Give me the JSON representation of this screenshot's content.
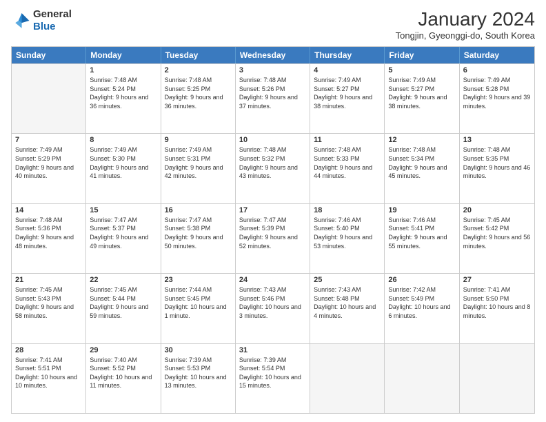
{
  "header": {
    "logo_general": "General",
    "logo_blue": "Blue",
    "month_title": "January 2024",
    "subtitle": "Tongjin, Gyeonggi-do, South Korea"
  },
  "weekdays": [
    "Sunday",
    "Monday",
    "Tuesday",
    "Wednesday",
    "Thursday",
    "Friday",
    "Saturday"
  ],
  "rows": [
    [
      {
        "day": "",
        "empty": true
      },
      {
        "day": "1",
        "sunrise": "7:48 AM",
        "sunset": "5:24 PM",
        "daylight": "9 hours and 36 minutes."
      },
      {
        "day": "2",
        "sunrise": "7:48 AM",
        "sunset": "5:25 PM",
        "daylight": "9 hours and 36 minutes."
      },
      {
        "day": "3",
        "sunrise": "7:48 AM",
        "sunset": "5:26 PM",
        "daylight": "9 hours and 37 minutes."
      },
      {
        "day": "4",
        "sunrise": "7:49 AM",
        "sunset": "5:27 PM",
        "daylight": "9 hours and 38 minutes."
      },
      {
        "day": "5",
        "sunrise": "7:49 AM",
        "sunset": "5:27 PM",
        "daylight": "9 hours and 38 minutes."
      },
      {
        "day": "6",
        "sunrise": "7:49 AM",
        "sunset": "5:28 PM",
        "daylight": "9 hours and 39 minutes."
      }
    ],
    [
      {
        "day": "7",
        "sunrise": "7:49 AM",
        "sunset": "5:29 PM",
        "daylight": "9 hours and 40 minutes."
      },
      {
        "day": "8",
        "sunrise": "7:49 AM",
        "sunset": "5:30 PM",
        "daylight": "9 hours and 41 minutes."
      },
      {
        "day": "9",
        "sunrise": "7:49 AM",
        "sunset": "5:31 PM",
        "daylight": "9 hours and 42 minutes."
      },
      {
        "day": "10",
        "sunrise": "7:48 AM",
        "sunset": "5:32 PM",
        "daylight": "9 hours and 43 minutes."
      },
      {
        "day": "11",
        "sunrise": "7:48 AM",
        "sunset": "5:33 PM",
        "daylight": "9 hours and 44 minutes."
      },
      {
        "day": "12",
        "sunrise": "7:48 AM",
        "sunset": "5:34 PM",
        "daylight": "9 hours and 45 minutes."
      },
      {
        "day": "13",
        "sunrise": "7:48 AM",
        "sunset": "5:35 PM",
        "daylight": "9 hours and 46 minutes."
      }
    ],
    [
      {
        "day": "14",
        "sunrise": "7:48 AM",
        "sunset": "5:36 PM",
        "daylight": "9 hours and 48 minutes."
      },
      {
        "day": "15",
        "sunrise": "7:47 AM",
        "sunset": "5:37 PM",
        "daylight": "9 hours and 49 minutes."
      },
      {
        "day": "16",
        "sunrise": "7:47 AM",
        "sunset": "5:38 PM",
        "daylight": "9 hours and 50 minutes."
      },
      {
        "day": "17",
        "sunrise": "7:47 AM",
        "sunset": "5:39 PM",
        "daylight": "9 hours and 52 minutes."
      },
      {
        "day": "18",
        "sunrise": "7:46 AM",
        "sunset": "5:40 PM",
        "daylight": "9 hours and 53 minutes."
      },
      {
        "day": "19",
        "sunrise": "7:46 AM",
        "sunset": "5:41 PM",
        "daylight": "9 hours and 55 minutes."
      },
      {
        "day": "20",
        "sunrise": "7:45 AM",
        "sunset": "5:42 PM",
        "daylight": "9 hours and 56 minutes."
      }
    ],
    [
      {
        "day": "21",
        "sunrise": "7:45 AM",
        "sunset": "5:43 PM",
        "daylight": "9 hours and 58 minutes."
      },
      {
        "day": "22",
        "sunrise": "7:45 AM",
        "sunset": "5:44 PM",
        "daylight": "9 hours and 59 minutes."
      },
      {
        "day": "23",
        "sunrise": "7:44 AM",
        "sunset": "5:45 PM",
        "daylight": "10 hours and 1 minute."
      },
      {
        "day": "24",
        "sunrise": "7:43 AM",
        "sunset": "5:46 PM",
        "daylight": "10 hours and 3 minutes."
      },
      {
        "day": "25",
        "sunrise": "7:43 AM",
        "sunset": "5:48 PM",
        "daylight": "10 hours and 4 minutes."
      },
      {
        "day": "26",
        "sunrise": "7:42 AM",
        "sunset": "5:49 PM",
        "daylight": "10 hours and 6 minutes."
      },
      {
        "day": "27",
        "sunrise": "7:41 AM",
        "sunset": "5:50 PM",
        "daylight": "10 hours and 8 minutes."
      }
    ],
    [
      {
        "day": "28",
        "sunrise": "7:41 AM",
        "sunset": "5:51 PM",
        "daylight": "10 hours and 10 minutes."
      },
      {
        "day": "29",
        "sunrise": "7:40 AM",
        "sunset": "5:52 PM",
        "daylight": "10 hours and 11 minutes."
      },
      {
        "day": "30",
        "sunrise": "7:39 AM",
        "sunset": "5:53 PM",
        "daylight": "10 hours and 13 minutes."
      },
      {
        "day": "31",
        "sunrise": "7:39 AM",
        "sunset": "5:54 PM",
        "daylight": "10 hours and 15 minutes."
      },
      {
        "day": "",
        "empty": true
      },
      {
        "day": "",
        "empty": true
      },
      {
        "day": "",
        "empty": true
      }
    ]
  ],
  "labels": {
    "sunrise": "Sunrise:",
    "sunset": "Sunset:",
    "daylight": "Daylight:"
  }
}
